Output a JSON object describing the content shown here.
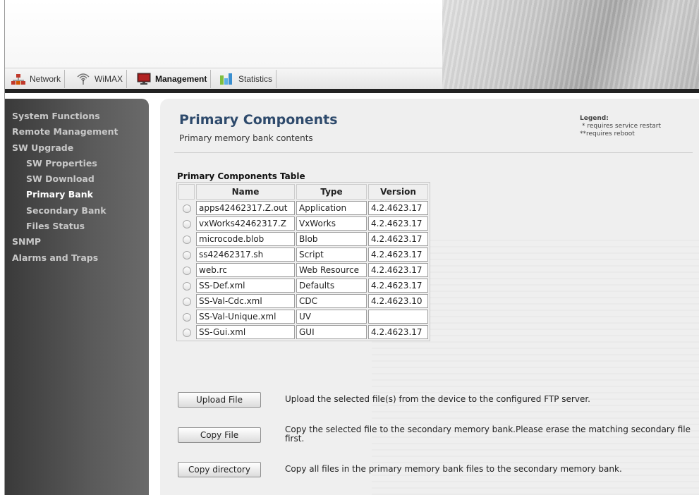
{
  "nav": {
    "tabs": [
      {
        "label": "Network",
        "icon": "network-icon"
      },
      {
        "label": "WiMAX",
        "icon": "wimax-antenna-icon"
      },
      {
        "label": "Management",
        "icon": "monitor-icon",
        "active": true
      },
      {
        "label": "Statistics",
        "icon": "bar-chart-icon"
      }
    ]
  },
  "sidebar": {
    "items": [
      {
        "label": "System Functions",
        "level": 1
      },
      {
        "label": "Remote Management",
        "level": 1
      },
      {
        "label": "SW Upgrade",
        "level": 1
      },
      {
        "label": "SW Properties",
        "level": 2
      },
      {
        "label": "SW Download",
        "level": 2
      },
      {
        "label": "Primary Bank",
        "level": 2,
        "active": true
      },
      {
        "label": "Secondary Bank",
        "level": 2
      },
      {
        "label": "Files Status",
        "level": 2
      },
      {
        "label": "SNMP",
        "level": 1
      },
      {
        "label": "Alarms and Traps",
        "level": 1
      }
    ]
  },
  "main": {
    "title": "Primary Components",
    "subtitle": "Primary memory bank contents",
    "legend": {
      "title": "Legend:",
      "restart_marker": "*",
      "restart_text": "requires service restart",
      "reboot_marker": "**",
      "reboot_text": "requires reboot"
    },
    "table": {
      "title": "Primary Components Table",
      "columns": [
        "Name",
        "Type",
        "Version"
      ],
      "rows": [
        {
          "name": "apps42462317.Z.out",
          "type": "Application",
          "version": "4.2.4623.17"
        },
        {
          "name": "vxWorks42462317.Z",
          "type": "VxWorks",
          "version": "4.2.4623.17"
        },
        {
          "name": "microcode.blob",
          "type": "Blob",
          "version": "4.2.4623.17"
        },
        {
          "name": "ss42462317.sh",
          "type": "Script",
          "version": "4.2.4623.17"
        },
        {
          "name": "web.rc",
          "type": "Web Resource",
          "version": "4.2.4623.17"
        },
        {
          "name": "SS-Def.xml",
          "type": "Defaults",
          "version": "4.2.4623.17"
        },
        {
          "name": "SS-Val-Cdc.xml",
          "type": "CDC",
          "version": "4.2.4623.10"
        },
        {
          "name": "SS-Val-Unique.xml",
          "type": "UV",
          "version": ""
        },
        {
          "name": "SS-Gui.xml",
          "type": "GUI",
          "version": "4.2.4623.17"
        }
      ]
    },
    "actions": {
      "upload": {
        "label": "Upload File",
        "description": "Upload the selected file(s) from the device to the configured FTP server."
      },
      "copy_file": {
        "label": "Copy File",
        "description": "Copy the selected file to the secondary memory bank.Please erase the matching secondary file first."
      },
      "copy_dir": {
        "label": "Copy directory",
        "description": "Copy all files in the primary memory bank files to the secondary memory bank."
      }
    }
  },
  "colors": {
    "title": "#2e4a6c",
    "sidebar_bg": "#4a4a4a",
    "content_bg": "#efefef",
    "top_bar": "#222222"
  }
}
